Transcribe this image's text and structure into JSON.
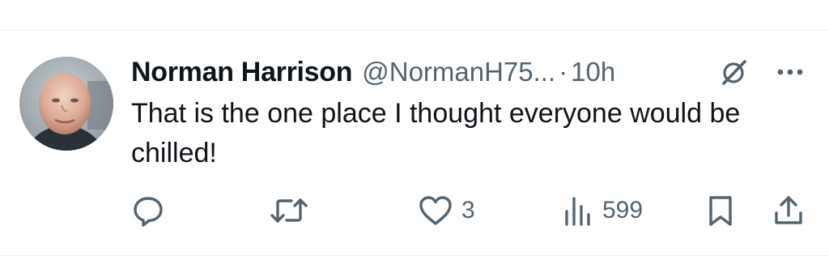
{
  "tweet": {
    "author_name": "Norman Harrison",
    "handle": "@NormanH75...",
    "separator": "·",
    "time": "10h",
    "text": "That is the one place I thought everyone would be chilled!"
  },
  "actions": {
    "reply_count": "",
    "retweet_count": "",
    "like_count": "3",
    "views_count": "599"
  },
  "icons": {
    "reply": "reply-icon",
    "retweet": "retweet-icon",
    "like": "heart-icon",
    "views": "views-icon",
    "bookmark": "bookmark-icon",
    "share": "share-icon",
    "grok": "grok-icon",
    "more": "more-icon"
  },
  "colors": {
    "text_primary": "#0f1419",
    "text_secondary": "#536471",
    "divider": "#eff3f4"
  }
}
